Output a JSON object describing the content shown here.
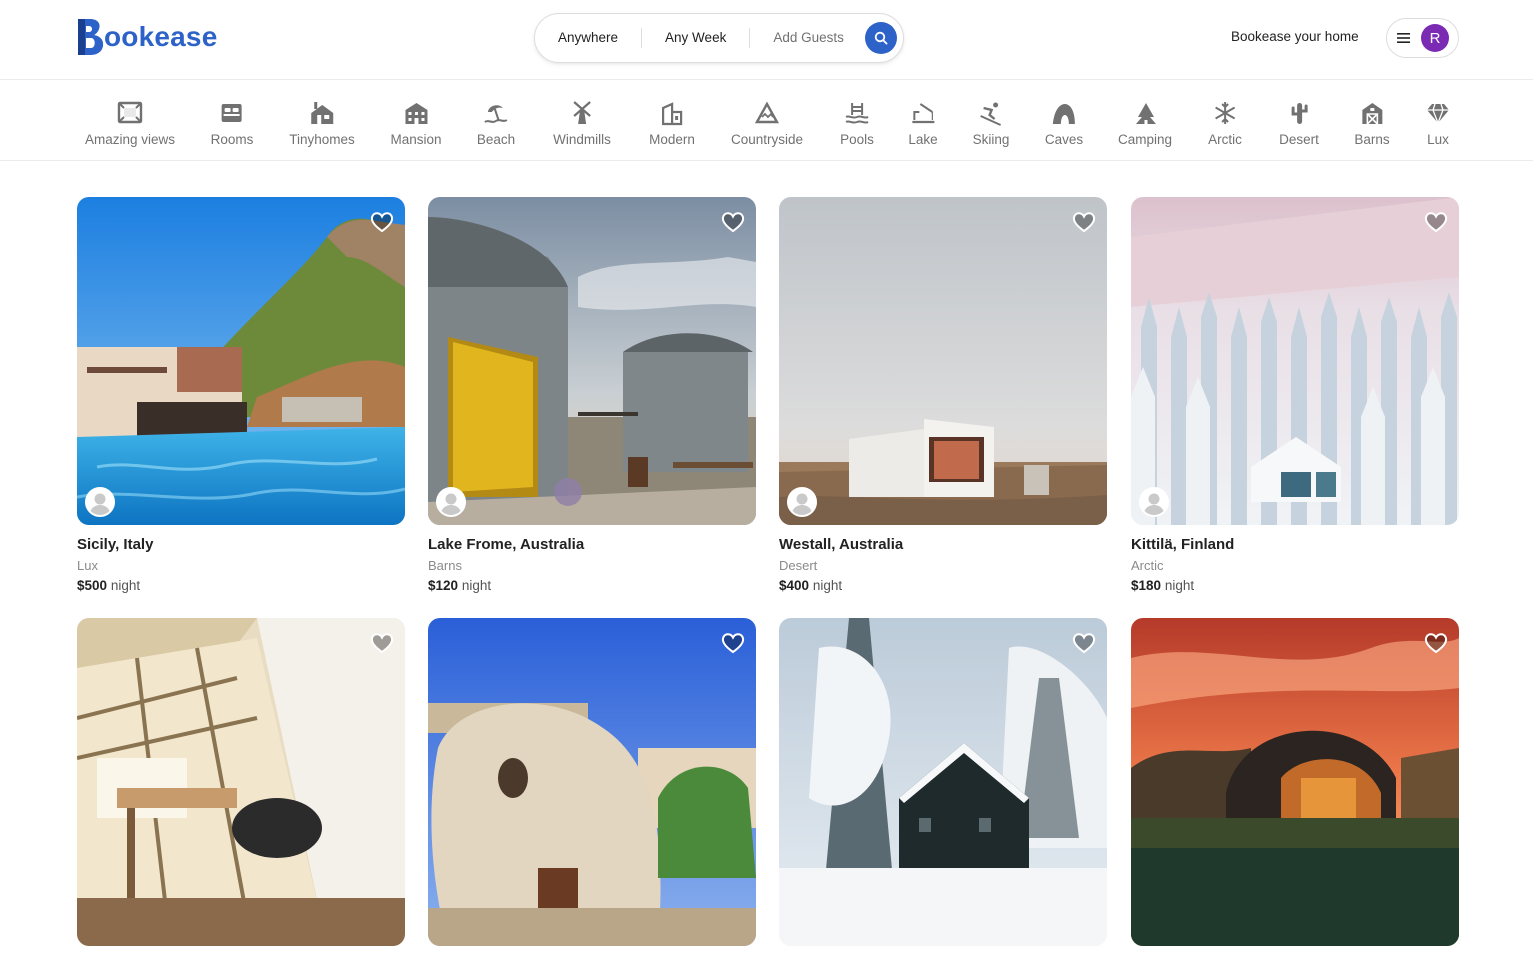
{
  "brand": {
    "name": "ookease",
    "initial": "B",
    "color": "#2d63c8"
  },
  "search": {
    "where": "Anywhere",
    "when": "Any Week",
    "guests": "Add Guests",
    "icon": "search-icon"
  },
  "header": {
    "host_link": "Bookease your home",
    "menu_icon": "hamburger-icon",
    "user_initial": "R"
  },
  "categories": [
    {
      "label": "Amazing views",
      "icon": "frame-icon"
    },
    {
      "label": "Rooms",
      "icon": "bed-icon"
    },
    {
      "label": "Tinyhomes",
      "icon": "tinyhome-icon"
    },
    {
      "label": "Mansion",
      "icon": "mansion-icon"
    },
    {
      "label": "Beach",
      "icon": "beach-icon"
    },
    {
      "label": "Windmills",
      "icon": "windmill-icon"
    },
    {
      "label": "Modern",
      "icon": "modern-building-icon"
    },
    {
      "label": "Countryside",
      "icon": "mountain-icon"
    },
    {
      "label": "Pools",
      "icon": "pool-icon"
    },
    {
      "label": "Lake",
      "icon": "lake-icon"
    },
    {
      "label": "Skiing",
      "icon": "skiing-icon"
    },
    {
      "label": "Caves",
      "icon": "cave-icon"
    },
    {
      "label": "Camping",
      "icon": "camping-icon"
    },
    {
      "label": "Arctic",
      "icon": "snowflake-icon"
    },
    {
      "label": "Desert",
      "icon": "cactus-icon"
    },
    {
      "label": "Barns",
      "icon": "barn-icon"
    },
    {
      "label": "Lux",
      "icon": "diamond-icon"
    }
  ],
  "listings": [
    {
      "location": "Sicily, Italy",
      "category": "Lux",
      "price": "$500",
      "unit": "night"
    },
    {
      "location": "Lake Frome, Australia",
      "category": "Barns",
      "price": "$120",
      "unit": "night"
    },
    {
      "location": "Westall, Australia",
      "category": "Desert",
      "price": "$400",
      "unit": "night"
    },
    {
      "location": "Kittilä, Finland",
      "category": "Arctic",
      "price": "$180",
      "unit": "night"
    },
    {
      "location": "",
      "category": "",
      "price": "",
      "unit": ""
    },
    {
      "location": "",
      "category": "",
      "price": "",
      "unit": ""
    },
    {
      "location": "",
      "category": "",
      "price": "",
      "unit": ""
    },
    {
      "location": "",
      "category": "",
      "price": "",
      "unit": ""
    }
  ]
}
